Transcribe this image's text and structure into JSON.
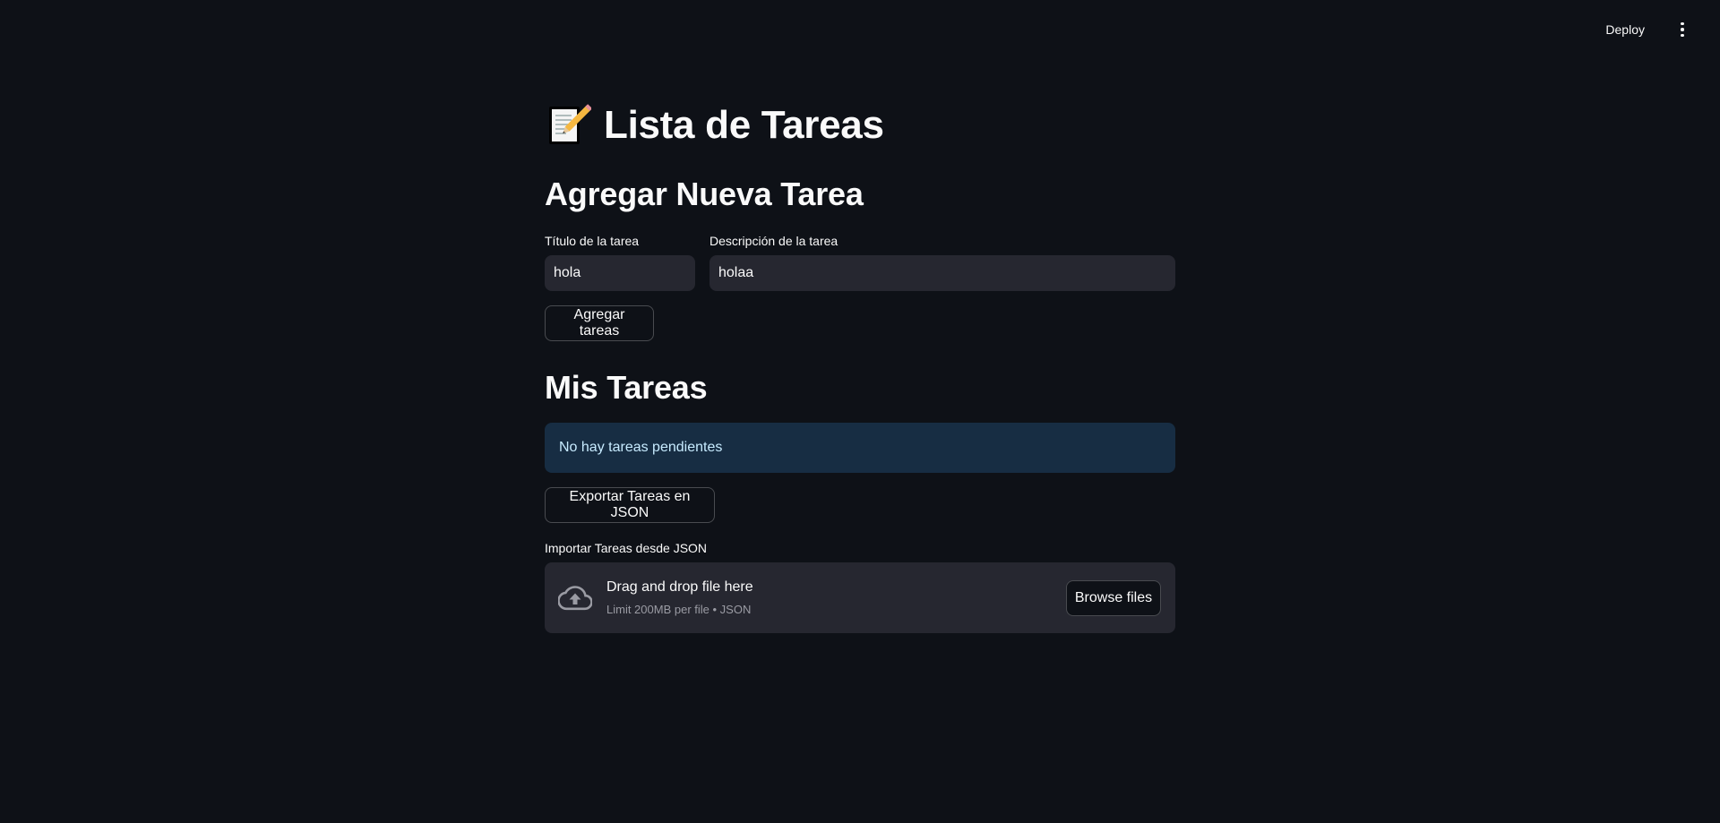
{
  "header": {
    "deploy_label": "Deploy",
    "menu_icon": "vertical-ellipsis-icon"
  },
  "page": {
    "title_icon": "memo-icon",
    "title": "Lista de Tareas"
  },
  "add_section": {
    "heading": "Agregar Nueva Tarea",
    "title_field": {
      "label": "Título de la tarea",
      "value": "hola"
    },
    "description_field": {
      "label": "Descripción de la tarea",
      "value": "holaa"
    },
    "add_button_label": "Agregar tareas"
  },
  "tasks_section": {
    "heading": "Mis Tareas",
    "empty_message": "No hay tareas pendientes",
    "export_button_label": "Exportar Tareas en JSON"
  },
  "import_section": {
    "label": "Importar Tareas desde JSON",
    "dropzone_title": "Drag and drop file here",
    "dropzone_limit": "Limit 200MB per file • JSON",
    "browse_button_label": "Browse files",
    "upload_icon": "cloud-upload-icon"
  },
  "colors": {
    "background": "#0e1117",
    "input_background": "#262730",
    "info_background": "#172d43",
    "info_text": "#c7ebff"
  }
}
